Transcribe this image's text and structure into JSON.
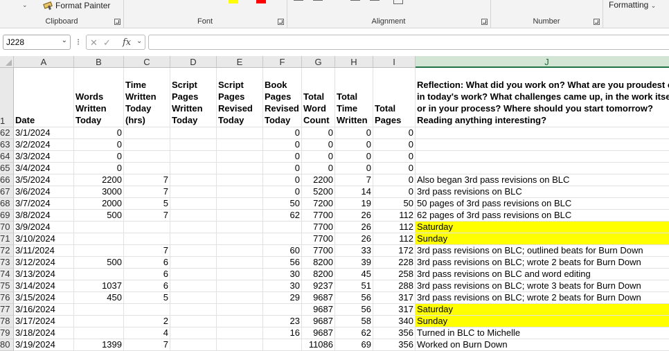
{
  "ribbon": {
    "format_painter": "Format Painter",
    "groups": [
      "Clipboard",
      "Font",
      "Alignment",
      "Number"
    ],
    "formatting": "Formatting"
  },
  "formula_bar": {
    "name_box": "J228",
    "fx": "fx",
    "formula": ""
  },
  "colors": {
    "highlight": "#ffff00",
    "font_swatch_1": "#ffff00",
    "font_swatch_2": "#ff0000",
    "accent": "#217346"
  },
  "columns": [
    "A",
    "B",
    "C",
    "D",
    "E",
    "F",
    "G",
    "H",
    "I",
    "J"
  ],
  "header_row": {
    "row_number": "1",
    "cells": [
      "Date",
      "Words Written Today",
      "Time Written Today (hrs)",
      "Script Pages Written Today",
      "Script Pages Revised Today",
      "Book Pages Revised Today",
      "Total Word Count",
      "Total Time Written",
      "Total Pages",
      "Reflection: What did you work on? What are you proudest of in today's work? What challenges came up, in the work itself or in your process? Where should you start tomorrow? Reading anything interesting?"
    ]
  },
  "rows": [
    {
      "n": "62",
      "c": [
        "3/1/2024",
        "0",
        "",
        "",
        "",
        "0",
        "0",
        "0",
        "0",
        ""
      ],
      "hl": false
    },
    {
      "n": "63",
      "c": [
        "3/2/2024",
        "0",
        "",
        "",
        "",
        "0",
        "0",
        "0",
        "0",
        ""
      ],
      "hl": false
    },
    {
      "n": "64",
      "c": [
        "3/3/2024",
        "0",
        "",
        "",
        "",
        "0",
        "0",
        "0",
        "0",
        ""
      ],
      "hl": false
    },
    {
      "n": "65",
      "c": [
        "3/4/2024",
        "0",
        "",
        "",
        "",
        "0",
        "0",
        "0",
        "0",
        ""
      ],
      "hl": false
    },
    {
      "n": "66",
      "c": [
        "3/5/2024",
        "2200",
        "7",
        "",
        "",
        "0",
        "2200",
        "7",
        "0",
        "Also began 3rd pass revisions on BLC"
      ],
      "hl": false
    },
    {
      "n": "67",
      "c": [
        "3/6/2024",
        "3000",
        "7",
        "",
        "",
        "0",
        "5200",
        "14",
        "0",
        "3rd pass revisions on BLC"
      ],
      "hl": false
    },
    {
      "n": "68",
      "c": [
        "3/7/2024",
        "2000",
        "5",
        "",
        "",
        "50",
        "7200",
        "19",
        "50",
        "50 pages of 3rd pass revisions on BLC"
      ],
      "hl": false
    },
    {
      "n": "69",
      "c": [
        "3/8/2024",
        "500",
        "7",
        "",
        "",
        "62",
        "7700",
        "26",
        "112",
        "62 pages of 3rd pass revisions on BLC"
      ],
      "hl": false
    },
    {
      "n": "70",
      "c": [
        "3/9/2024",
        "",
        "",
        "",
        "",
        "",
        "7700",
        "26",
        "112",
        "Saturday"
      ],
      "hl": true
    },
    {
      "n": "71",
      "c": [
        "3/10/2024",
        "",
        "",
        "",
        "",
        "",
        "7700",
        "26",
        "112",
        "Sunday"
      ],
      "hl": true
    },
    {
      "n": "72",
      "c": [
        "3/11/2024",
        "",
        "7",
        "",
        "",
        "60",
        "7700",
        "33",
        "172",
        "3rd pass revisions on BLC; outlined beats for Burn Down"
      ],
      "hl": false
    },
    {
      "n": "73",
      "c": [
        "3/12/2024",
        "500",
        "6",
        "",
        "",
        "56",
        "8200",
        "39",
        "228",
        "3rd pass revisions on BLC; wrote 2 beats for Burn Down"
      ],
      "hl": false
    },
    {
      "n": "74",
      "c": [
        "3/13/2024",
        "",
        "6",
        "",
        "",
        "30",
        "8200",
        "45",
        "258",
        "3rd pass revisions on BLC and word editing"
      ],
      "hl": false
    },
    {
      "n": "75",
      "c": [
        "3/14/2024",
        "1037",
        "6",
        "",
        "",
        "30",
        "9237",
        "51",
        "288",
        "3rd pass revisions on BLC; wrote 3 beats for Burn Down"
      ],
      "hl": false
    },
    {
      "n": "76",
      "c": [
        "3/15/2024",
        "450",
        "5",
        "",
        "",
        "29",
        "9687",
        "56",
        "317",
        "3rd pass revisions on BLC; wrote 2 beats for Burn Down"
      ],
      "hl": false
    },
    {
      "n": "77",
      "c": [
        "3/16/2024",
        "",
        "",
        "",
        "",
        "",
        "9687",
        "56",
        "317",
        "Saturday"
      ],
      "hl": true
    },
    {
      "n": "78",
      "c": [
        "3/17/2024",
        "",
        "2",
        "",
        "",
        "23",
        "9687",
        "58",
        "340",
        "Sunday"
      ],
      "hl": true
    },
    {
      "n": "79",
      "c": [
        "3/18/2024",
        "",
        "4",
        "",
        "",
        "16",
        "9687",
        "62",
        "356",
        "Turned in BLC to Michelle"
      ],
      "hl": false
    },
    {
      "n": "80",
      "c": [
        "3/19/2024",
        "1399",
        "7",
        "",
        "",
        "",
        "11086",
        "69",
        "356",
        "Worked on Burn Down"
      ],
      "hl": false
    }
  ]
}
